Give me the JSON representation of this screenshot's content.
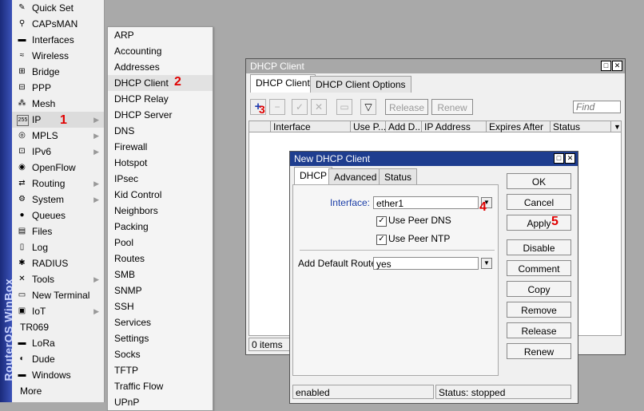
{
  "brand": "RouterOS WinBox",
  "left_menu": [
    {
      "label": "Quick Set",
      "icon": "wand-icon",
      "icon_glyph": "✎"
    },
    {
      "label": "CAPsMAN",
      "icon": "capsman-icon",
      "icon_glyph": "⚲"
    },
    {
      "label": "Interfaces",
      "icon": "interfaces-icon",
      "icon_glyph": "▬"
    },
    {
      "label": "Wireless",
      "icon": "wireless-icon",
      "icon_glyph": "≈"
    },
    {
      "label": "Bridge",
      "icon": "bridge-icon",
      "icon_glyph": "⊞"
    },
    {
      "label": "PPP",
      "icon": "ppp-icon",
      "icon_glyph": "⊟"
    },
    {
      "label": "Mesh",
      "icon": "mesh-icon",
      "icon_glyph": "⁂"
    },
    {
      "label": "IP",
      "icon": "ip-icon",
      "icon_glyph": "255"
    },
    {
      "label": "MPLS",
      "icon": "mpls-icon",
      "icon_glyph": "◎"
    },
    {
      "label": "IPv6",
      "icon": "ipv6-icon",
      "icon_glyph": "⊡"
    },
    {
      "label": "OpenFlow",
      "icon": "openflow-icon",
      "icon_glyph": "◉"
    },
    {
      "label": "Routing",
      "icon": "routing-icon",
      "icon_glyph": "⇄"
    },
    {
      "label": "System",
      "icon": "system-gear-icon",
      "icon_glyph": "⚙"
    },
    {
      "label": "Queues",
      "icon": "queues-icon",
      "icon_glyph": "●"
    },
    {
      "label": "Files",
      "icon": "files-icon",
      "icon_glyph": "▤"
    },
    {
      "label": "Log",
      "icon": "log-icon",
      "icon_glyph": "▯"
    },
    {
      "label": "RADIUS",
      "icon": "radius-icon",
      "icon_glyph": "✱"
    },
    {
      "label": "Tools",
      "icon": "tools-icon",
      "icon_glyph": "✕"
    },
    {
      "label": "New Terminal",
      "icon": "terminal-icon",
      "icon_glyph": "▭"
    },
    {
      "label": "IoT",
      "icon": "iot-icon",
      "icon_glyph": "▣"
    },
    {
      "label": "TR069",
      "icon": "",
      "icon_glyph": ""
    },
    {
      "label": "LoRa",
      "icon": "lora-icon",
      "icon_glyph": "▬"
    },
    {
      "label": "Dude",
      "icon": "dude-icon",
      "icon_glyph": "◐"
    },
    {
      "label": "Windows",
      "icon": "windows-icon",
      "icon_glyph": "▬"
    },
    {
      "label": "More",
      "icon": "",
      "icon_glyph": ""
    }
  ],
  "submenu": [
    "ARP",
    "Accounting",
    "Addresses",
    "DHCP Client",
    "DHCP Relay",
    "DHCP Server",
    "DNS",
    "Firewall",
    "Hotspot",
    "IPsec",
    "Kid Control",
    "Neighbors",
    "Packing",
    "Pool",
    "Routes",
    "SMB",
    "SNMP",
    "SSH",
    "Services",
    "Settings",
    "Socks",
    "TFTP",
    "Traffic Flow",
    "UPnP"
  ],
  "markers": {
    "m1": "1",
    "m2": "2",
    "m3": "3",
    "m4": "4",
    "m5": "5"
  },
  "dhcp_client_window": {
    "title": "DHCP Client",
    "tabs": [
      "DHCP Client",
      "DHCP Client Options"
    ],
    "release": "Release",
    "renew": "Renew",
    "find_placeholder": "Find",
    "columns": [
      "Interface",
      "Use P...",
      "Add D...",
      "IP Address",
      "Expires After",
      "Status"
    ],
    "item_count": "0 items"
  },
  "new_dhcp_window": {
    "title": "New DHCP Client",
    "tabs": [
      "DHCP",
      "Advanced",
      "Status"
    ],
    "interface_label": "Interface:",
    "interface_value": "ether1",
    "use_peer_dns": "Use Peer DNS",
    "use_peer_ntp": "Use Peer NTP",
    "add_default_route_label": "Add Default Route:",
    "add_default_route_value": "yes",
    "buttons": {
      "ok": "OK",
      "cancel": "Cancel",
      "apply": "Apply",
      "disable": "Disable",
      "comment": "Comment",
      "copy": "Copy",
      "remove": "Remove",
      "release": "Release",
      "renew": "Renew"
    },
    "status_left": "enabled",
    "status_right": "Status: stopped"
  },
  "colors": {
    "accent_label": "#1c3fa8",
    "marker": "#e00000",
    "titlebar_active": "#1e3d8f"
  }
}
